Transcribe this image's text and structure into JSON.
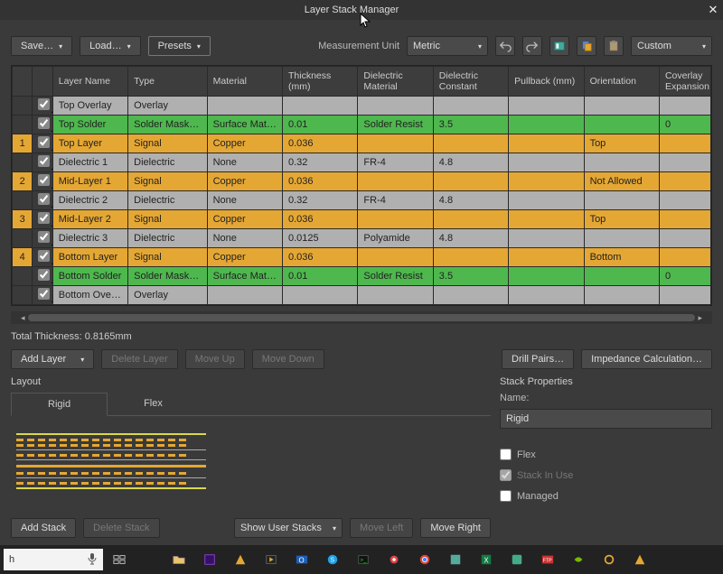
{
  "window": {
    "title": "Layer Stack Manager"
  },
  "toolbar": {
    "save": "Save…",
    "load": "Load…",
    "presets": "Presets",
    "measurement_unit_label": "Measurement Unit",
    "measurement_unit_value": "Metric",
    "custom": "Custom"
  },
  "columns": [
    "",
    "",
    "Layer Name",
    "Type",
    "Material",
    "Thickness (mm)",
    "Dielectric Material",
    "Dielectric Constant",
    "Pullback (mm)",
    "Orientation",
    "Coverlay Expansion"
  ],
  "rows": [
    {
      "num": "",
      "rowcolor": "gray",
      "name": "Top Overlay",
      "type": "Overlay",
      "material": "",
      "thickness": "",
      "diel_mat": "",
      "diel_const": "",
      "pullback": "",
      "orientation": "",
      "coverlay": ""
    },
    {
      "num": "",
      "rowcolor": "green",
      "name": "Top Solder",
      "type": "Solder Mask/Co…",
      "material": "Surface Material",
      "thickness": "0.01",
      "diel_mat": "Solder Resist",
      "diel_const": "3.5",
      "pullback": "",
      "orientation": "",
      "coverlay": "0"
    },
    {
      "num": "1",
      "rowcolor": "orange",
      "name": "Top Layer",
      "type": "Signal",
      "material": "Copper",
      "thickness": "0.036",
      "diel_mat": "",
      "diel_const": "",
      "pullback": "",
      "orientation": "Top",
      "coverlay": ""
    },
    {
      "num": "",
      "rowcolor": "gray",
      "name": "Dielectric 1",
      "type": "Dielectric",
      "material": "None",
      "thickness": "0.32",
      "diel_mat": "FR-4",
      "diel_const": "4.8",
      "pullback": "",
      "orientation": "",
      "coverlay": ""
    },
    {
      "num": "2",
      "rowcolor": "orange",
      "name": "Mid-Layer 1",
      "type": "Signal",
      "material": "Copper",
      "thickness": "0.036",
      "diel_mat": "",
      "diel_const": "",
      "pullback": "",
      "orientation": "Not Allowed",
      "coverlay": ""
    },
    {
      "num": "",
      "rowcolor": "gray",
      "name": "Dielectric 2",
      "type": "Dielectric",
      "material": "None",
      "thickness": "0.32",
      "diel_mat": "FR-4",
      "diel_const": "4.8",
      "pullback": "",
      "orientation": "",
      "coverlay": ""
    },
    {
      "num": "3",
      "rowcolor": "orange",
      "name": "Mid-Layer 2",
      "type": "Signal",
      "material": "Copper",
      "thickness": "0.036",
      "diel_mat": "",
      "diel_const": "",
      "pullback": "",
      "orientation": "Top",
      "coverlay": ""
    },
    {
      "num": "",
      "rowcolor": "gray",
      "name": "Dielectric 3",
      "type": "Dielectric",
      "material": "None",
      "thickness": "0.0125",
      "diel_mat": "Polyamide",
      "diel_const": "4.8",
      "pullback": "",
      "orientation": "",
      "coverlay": ""
    },
    {
      "num": "4",
      "rowcolor": "orange",
      "name": "Bottom Layer",
      "type": "Signal",
      "material": "Copper",
      "thickness": "0.036",
      "diel_mat": "",
      "diel_const": "",
      "pullback": "",
      "orientation": "Bottom",
      "coverlay": ""
    },
    {
      "num": "",
      "rowcolor": "green",
      "name": "Bottom Solder",
      "type": "Solder Mask/Co…",
      "material": "Surface Material",
      "thickness": "0.01",
      "diel_mat": "Solder Resist",
      "diel_const": "3.5",
      "pullback": "",
      "orientation": "",
      "coverlay": "0"
    },
    {
      "num": "",
      "rowcolor": "gray",
      "name": "Bottom Overlay",
      "type": "Overlay",
      "material": "",
      "thickness": "",
      "diel_mat": "",
      "diel_const": "",
      "pullback": "",
      "orientation": "",
      "coverlay": ""
    }
  ],
  "total_thickness": "Total Thickness: 0.8165mm",
  "midbar": {
    "add_layer": "Add Layer",
    "delete_layer": "Delete Layer",
    "move_up": "Move Up",
    "move_down": "Move Down",
    "drill_pairs": "Drill Pairs…",
    "impedance": "Impedance Calculation…"
  },
  "layout": {
    "title": "Layout",
    "tab_rigid": "Rigid",
    "tab_flex": "Flex",
    "add_stack": "Add Stack",
    "delete_stack": "Delete Stack",
    "show_user_stacks": "Show User Stacks",
    "move_left": "Move Left",
    "move_right": "Move Right"
  },
  "props": {
    "title": "Stack Properties",
    "name_label": "Name:",
    "name_value": "Rigid",
    "flex": "Flex",
    "stack_in_use": "Stack In Use",
    "managed": "Managed"
  },
  "taskbar": {
    "search": "h"
  }
}
